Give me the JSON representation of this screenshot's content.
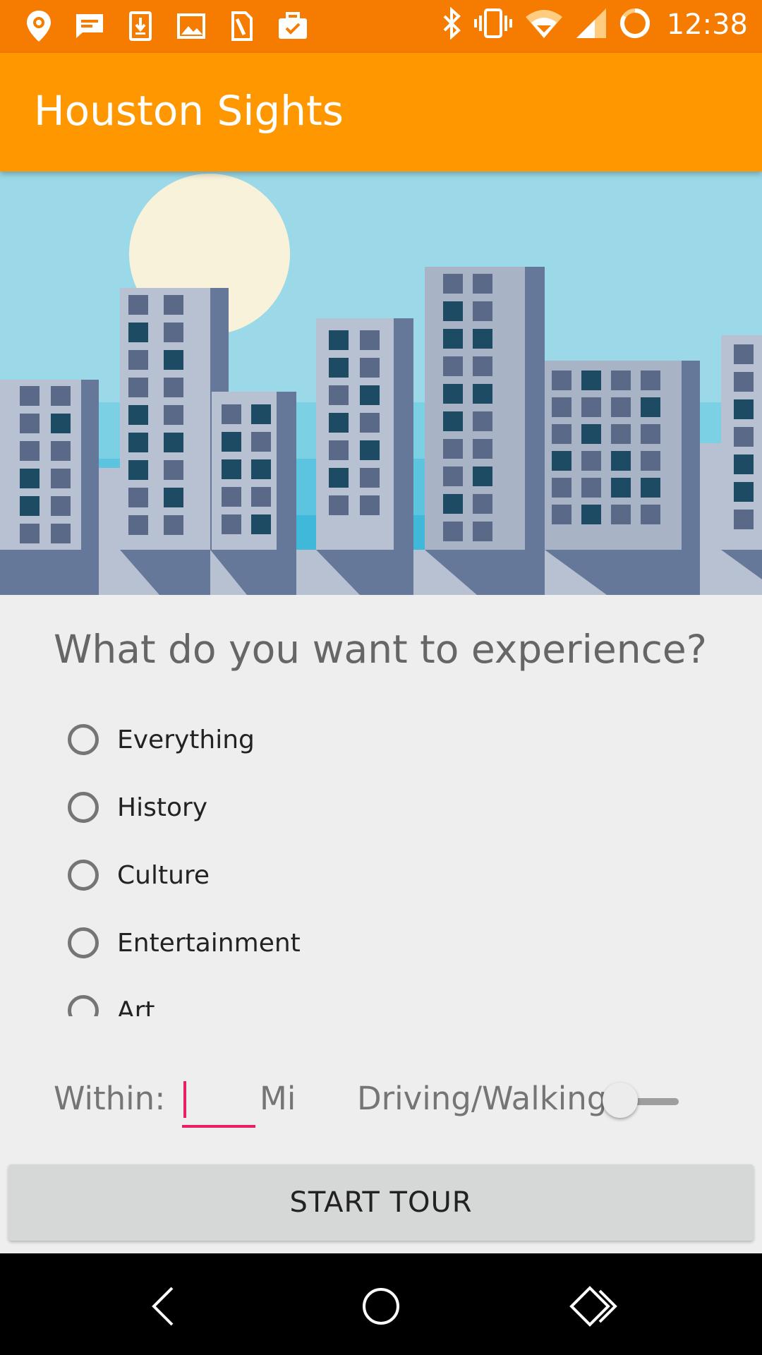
{
  "status_bar": {
    "time": "12:38",
    "left_icons": [
      "location-pin-icon",
      "message-icon",
      "download-icon",
      "image-icon",
      "sim-icon",
      "briefcase-check-icon"
    ],
    "right_icons": [
      "bluetooth-icon",
      "vibrate-icon",
      "wifi-icon",
      "signal-icon",
      "battery-ring-icon"
    ]
  },
  "app_bar": {
    "title": "Houston Sights"
  },
  "colors": {
    "status_bar": "#f57c00",
    "app_bar": "#ff9800",
    "accent": "#e91e63",
    "background": "#eeeeee"
  },
  "form": {
    "question": "What do you want to experience?",
    "options": [
      {
        "label": "Everything",
        "selected": false
      },
      {
        "label": "History",
        "selected": false
      },
      {
        "label": "Culture",
        "selected": false
      },
      {
        "label": "Entertainment",
        "selected": false
      },
      {
        "label": "Art",
        "selected": false
      }
    ],
    "within_label": "Within:",
    "distance_value": "",
    "unit_label": "Mi",
    "mode_label": "Driving/Walking",
    "mode_switch_on": false,
    "start_button": "START TOUR"
  },
  "nav": {
    "icons": [
      "back-icon",
      "home-icon",
      "recents-icon"
    ]
  }
}
